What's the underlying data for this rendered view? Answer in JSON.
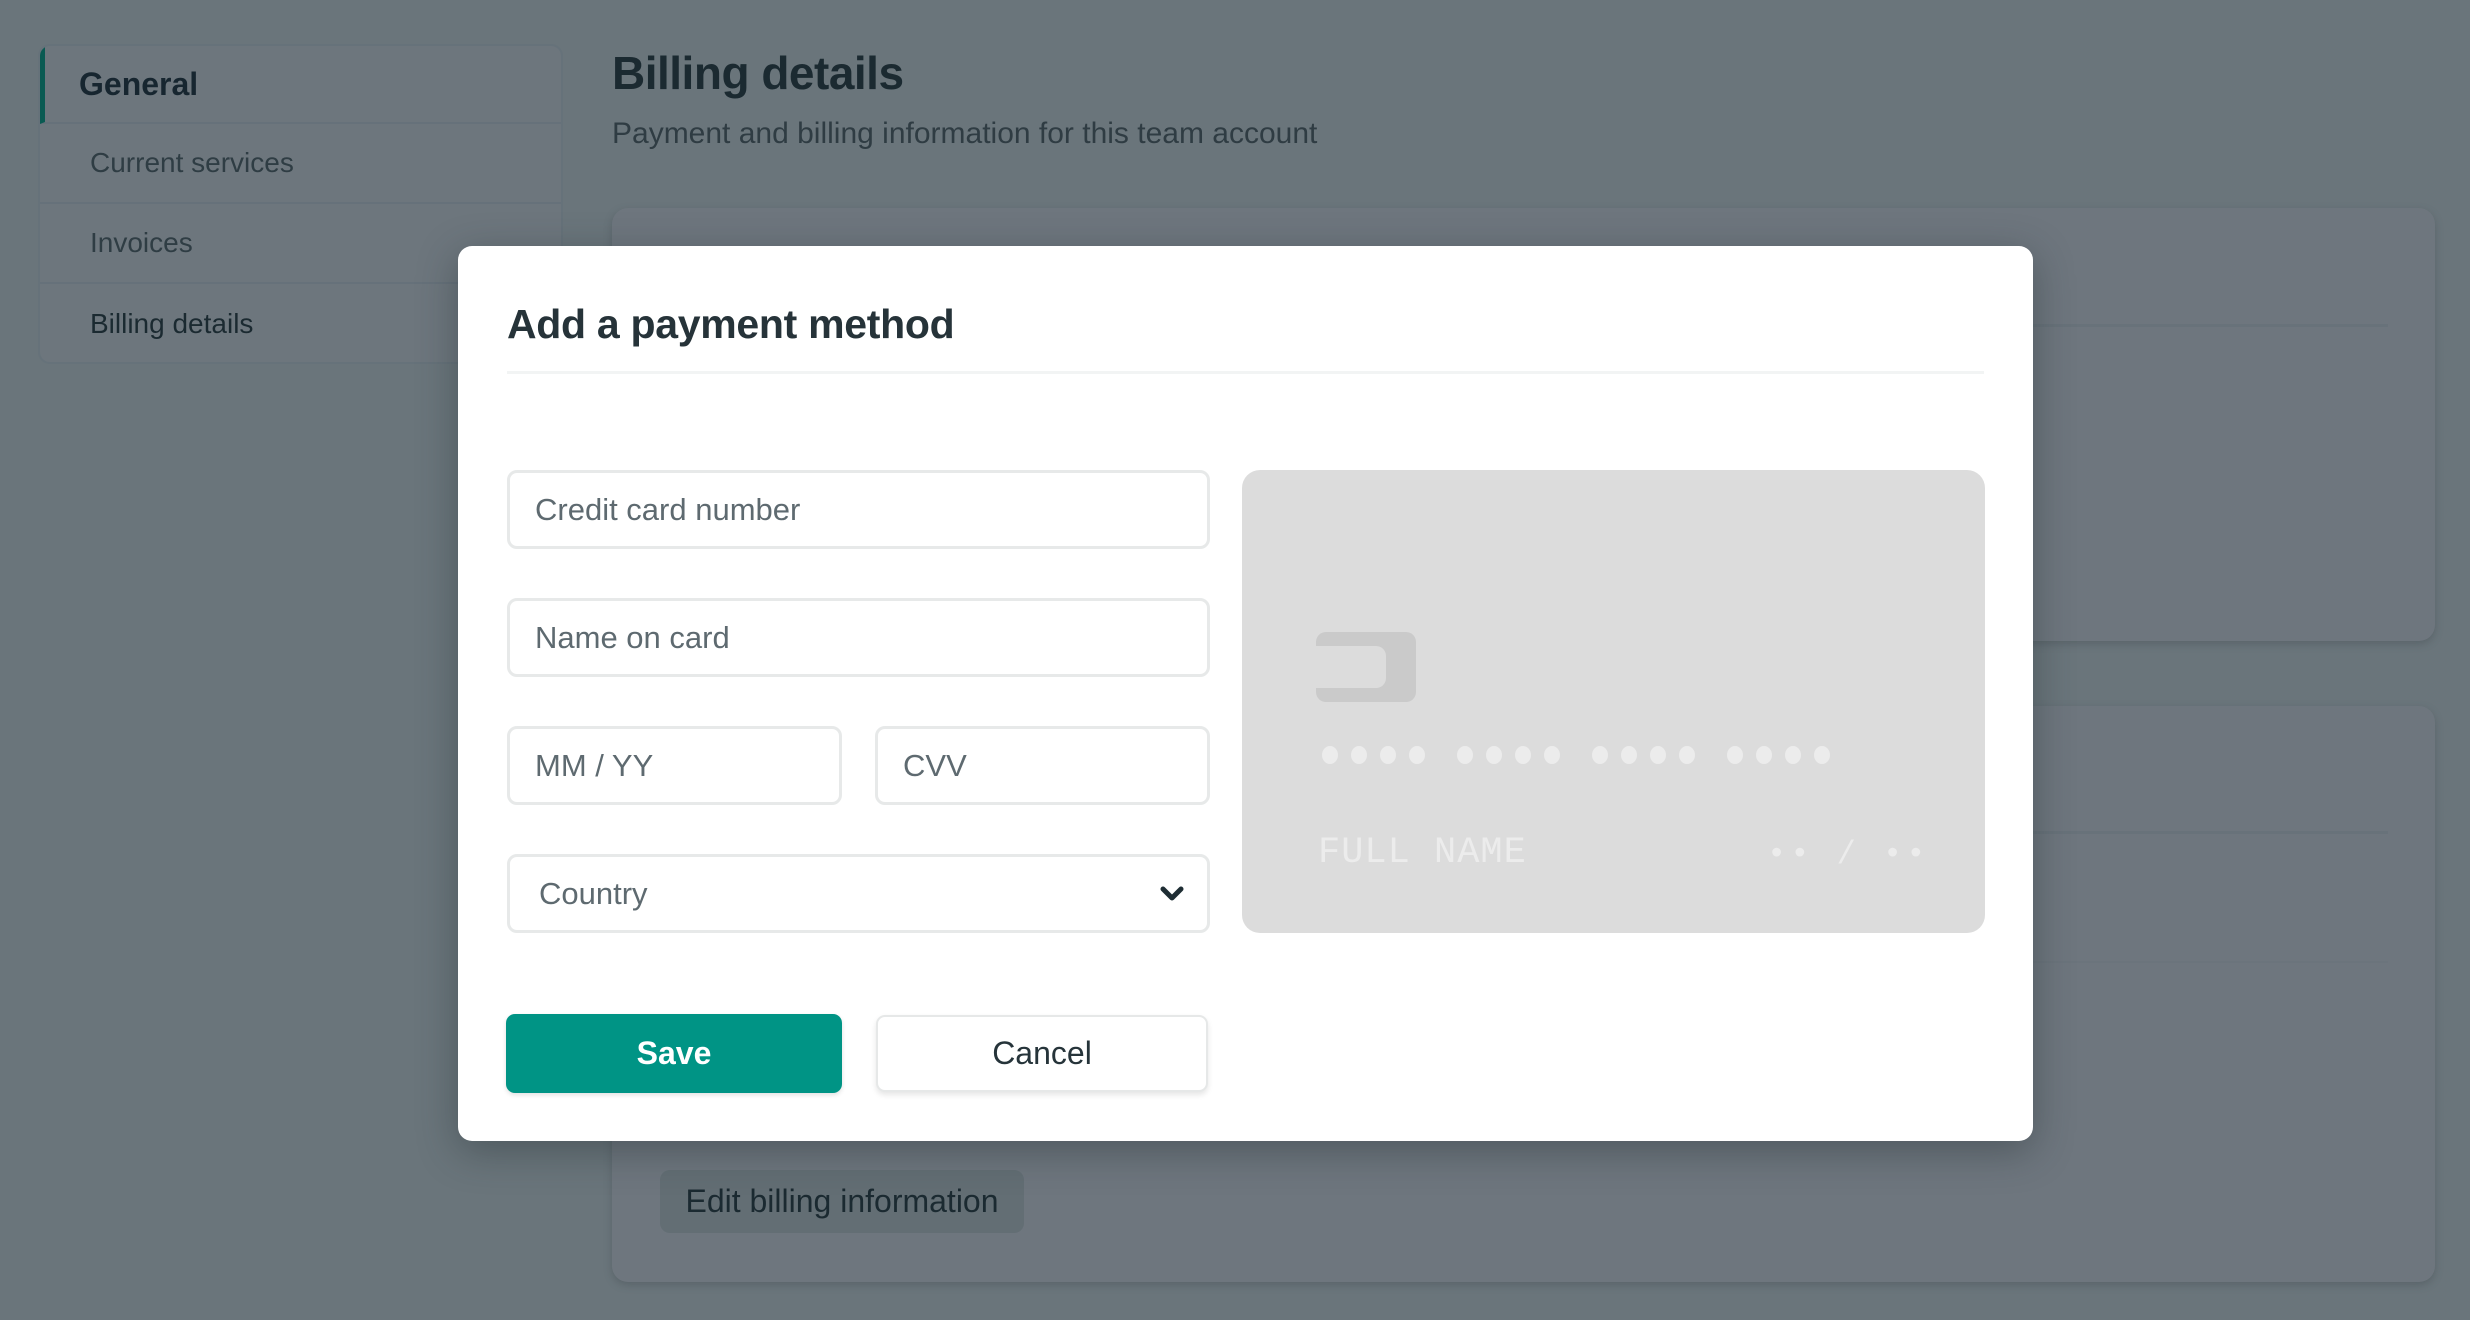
{
  "sidebar": {
    "heading": "General",
    "items": [
      {
        "label": "Current services"
      },
      {
        "label": "Invoices"
      },
      {
        "label": "Billing details"
      }
    ]
  },
  "page": {
    "title": "Billing details",
    "subtitle": "Payment and billing information for this team account",
    "edit_button_label": "Edit billing information"
  },
  "modal": {
    "title": "Add a payment method",
    "fields": {
      "card_number": {
        "placeholder": "Credit card number",
        "value": ""
      },
      "name_on_card": {
        "placeholder": "Name on card",
        "value": ""
      },
      "expiry": {
        "placeholder": "MM / YY",
        "value": ""
      },
      "cvv": {
        "placeholder": "CVV",
        "value": ""
      },
      "country": {
        "selected": "Country"
      }
    },
    "save_label": "Save",
    "cancel_label": "Cancel",
    "card_preview": {
      "number_mask_groups": 4,
      "digits_per_group": 4,
      "name_placeholder": "FULL NAME",
      "expiry_placeholder": "•• / ••"
    }
  },
  "colors": {
    "accent": "#009485",
    "sidebar_active_bar": "#0a5a52",
    "card_preview_bg": "#dcdcdc",
    "overlay_bg": "#6a757b"
  },
  "icons": {
    "country_dropdown": "chevron-down-icon",
    "card_chip": "card-chip-icon"
  }
}
